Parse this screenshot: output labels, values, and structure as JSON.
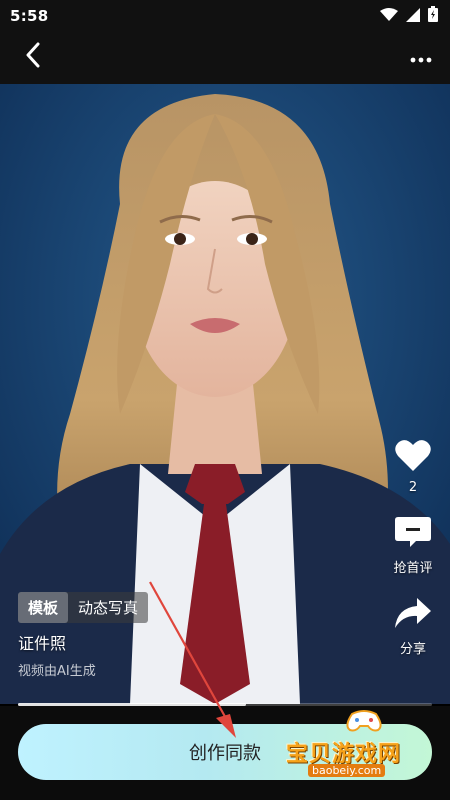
{
  "status_bar": {
    "time": "5:58"
  },
  "side_actions": {
    "like_count": "2",
    "comment_label": "抢首评",
    "share_label": "分享"
  },
  "video": {
    "tag_primary": "模板",
    "tag_secondary": "动态写真",
    "title": "证件照",
    "note": "视频由AI生成",
    "progress": 0.55
  },
  "create_button": {
    "label": "创作同款"
  },
  "watermark": {
    "title": "宝贝游戏网",
    "url": "baobeiy.com"
  },
  "colors": {
    "accent_gradient_start": "#bff2ff",
    "accent_gradient_end": "#c3f7d6",
    "annotation_arrow": "#e0463c",
    "watermark": "#f6a21a"
  },
  "icons": [
    "back-arrow-icon",
    "more-icon",
    "heart-icon",
    "comment-icon",
    "share-icon",
    "wifi-icon",
    "signal-icon",
    "battery-icon"
  ]
}
